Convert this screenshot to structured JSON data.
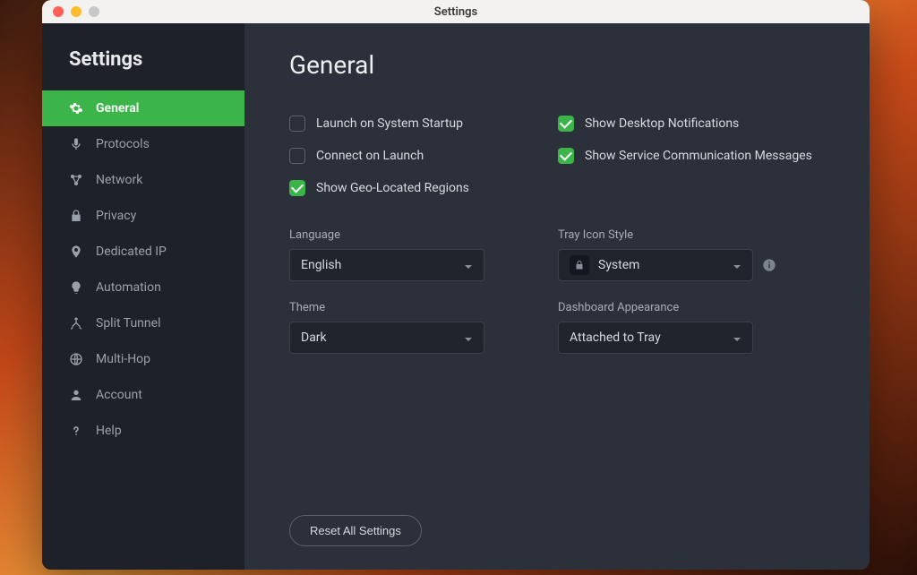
{
  "window": {
    "title": "Settings"
  },
  "sidebar": {
    "title": "Settings",
    "items": [
      {
        "label": "General",
        "icon": "gear-icon",
        "active": true
      },
      {
        "label": "Protocols",
        "icon": "mic-icon",
        "active": false
      },
      {
        "label": "Network",
        "icon": "network-icon",
        "active": false
      },
      {
        "label": "Privacy",
        "icon": "lock-icon",
        "active": false
      },
      {
        "label": "Dedicated IP",
        "icon": "pin-icon",
        "active": false
      },
      {
        "label": "Automation",
        "icon": "bulb-icon",
        "active": false
      },
      {
        "label": "Split Tunnel",
        "icon": "split-icon",
        "active": false
      },
      {
        "label": "Multi-Hop",
        "icon": "globe-icon",
        "active": false
      },
      {
        "label": "Account",
        "icon": "person-icon",
        "active": false
      },
      {
        "label": "Help",
        "icon": "question-icon",
        "active": false
      }
    ]
  },
  "page": {
    "title": "General"
  },
  "checkboxes": {
    "launch_startup": {
      "label": "Launch on System Startup",
      "checked": false
    },
    "desktop_notif": {
      "label": "Show Desktop Notifications",
      "checked": true
    },
    "connect_launch": {
      "label": "Connect on Launch",
      "checked": false
    },
    "service_msgs": {
      "label": "Show Service Communication Messages",
      "checked": true
    },
    "geo_regions": {
      "label": "Show Geo-Located Regions",
      "checked": true
    }
  },
  "selects": {
    "language": {
      "label": "Language",
      "value": "English"
    },
    "tray": {
      "label": "Tray Icon Style",
      "value": "System"
    },
    "theme": {
      "label": "Theme",
      "value": "Dark"
    },
    "dashboard": {
      "label": "Dashboard Appearance",
      "value": "Attached to Tray"
    }
  },
  "buttons": {
    "reset": "Reset All Settings"
  },
  "colors": {
    "accent": "#3bb54a"
  }
}
